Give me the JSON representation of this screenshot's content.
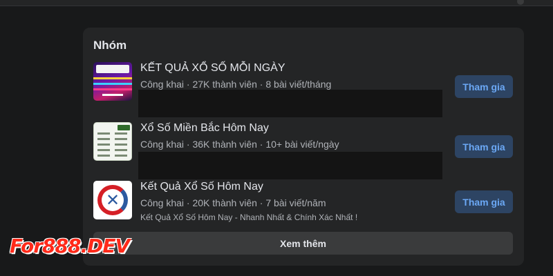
{
  "section": {
    "title": "Nhóm",
    "see_more_label": "Xem thêm"
  },
  "groups": [
    {
      "name": "KẾT QUẢ XỔ SỐ MỖI NGÀY",
      "meta": "Công khai · 27K thành viên · 8 bài viết/tháng",
      "description": "",
      "join_label": "Tham gia",
      "thumbnail_icon": "lottery-banner-image"
    },
    {
      "name": "Xổ Số Miền Bắc Hôm Nay",
      "meta": "Công khai · 36K thành viên · 10+ bài viết/ngày",
      "description": "",
      "join_label": "Tham gia",
      "thumbnail_icon": "lottery-results-table-image"
    },
    {
      "name": "Kết Quả Xổ Số Hôm Nay",
      "meta": "Công khai · 20K thành viên · 7 bài viết/năm",
      "description": "Kết Quả Xổ Số Hôm Nay - Nhanh Nhất & Chính Xác Nhất !",
      "join_label": "Tham gia",
      "thumbnail_icon": "xs-logo-image"
    }
  ],
  "watermark": "For888.DEV",
  "colors": {
    "background": "#18191a",
    "card": "#242526",
    "join_button_bg": "#2d4463",
    "join_button_text": "#6ba8f5",
    "see_more_bg": "#3a3b3c",
    "watermark": "#ff2a1a"
  }
}
